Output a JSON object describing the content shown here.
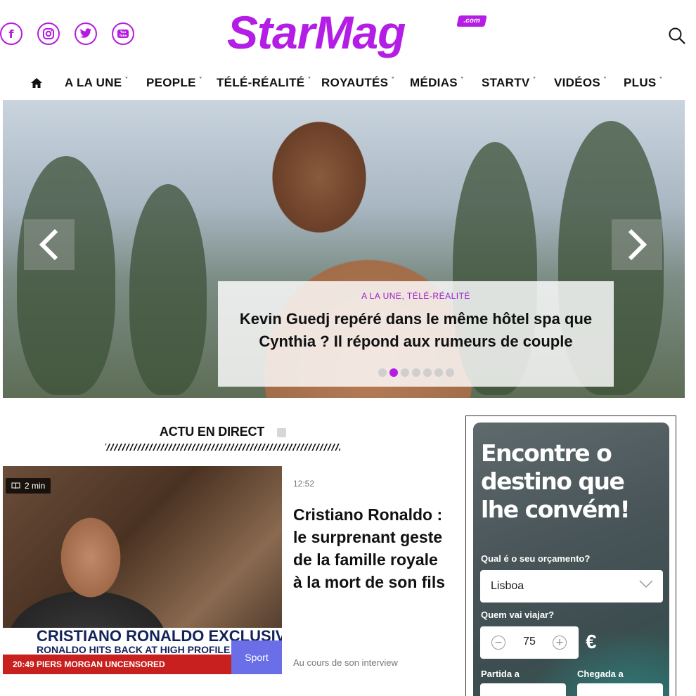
{
  "header": {
    "logo_text": "StarMag",
    "logo_suffix": ".com",
    "social": [
      {
        "name": "facebook-icon",
        "glyph": "f"
      },
      {
        "name": "instagram-icon",
        "glyph": "◎"
      },
      {
        "name": "twitter-icon",
        "glyph": "🐦"
      },
      {
        "name": "youtube-icon",
        "glyph": "You Tube"
      }
    ]
  },
  "nav": {
    "items": [
      "A LA UNE",
      "PEOPLE",
      "TÉLÉ-RÉALITÉ",
      "ROYAUTÉS",
      "MÉDIAS",
      "STARTV",
      "VIDÉOS",
      "PLUS"
    ],
    "chevron": "˅"
  },
  "hero": {
    "category": "A LA UNE, TÉLÉ-RÉALITÉ",
    "title": "Kevin Guedj repéré dans le même hôtel spa que Cynthia ? Il répond aux rumeurs de couple",
    "slide_count": 7,
    "active_slide": 2
  },
  "section": {
    "title": "ACTU EN DIRECT"
  },
  "article": {
    "read_time": "2 min",
    "time": "12:52",
    "title": "Cristiano Ronaldo : le surprenant geste de la famille royale à la mort de son fils",
    "excerpt": "Au cours de son interview",
    "tag": "Sport",
    "image_banner_line1": "CRISTIANO RONALDO EXCLUSIVE",
    "image_banner_line2": "RONALDO HITS BACK AT HIGH PROFILE",
    "image_ticker": "20:49   PIERS MORGAN   UNCENSORED"
  },
  "ad": {
    "headline": "Encontre o destino que lhe convém!",
    "budget_label": "Qual é o seu orçamento?",
    "budget_value": "Lisboa",
    "travelers_label": "Quem vai viajar?",
    "travelers_value": "75",
    "currency": "€",
    "departure_label": "Partida a",
    "arrival_label": "Chegada a"
  },
  "colors": {
    "brand": "#b41de6",
    "tag": "#6a6fe8"
  }
}
